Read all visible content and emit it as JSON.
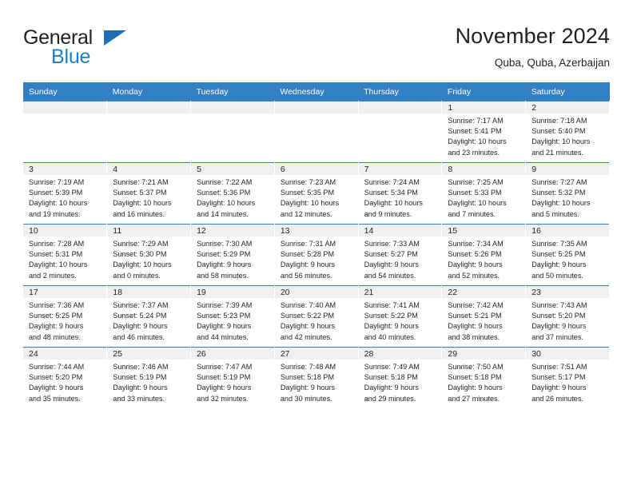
{
  "brand": {
    "name_part1": "General",
    "name_part2": "Blue",
    "triangle_color": "#1d6fb4",
    "blue_color": "#1d7dc4"
  },
  "header": {
    "title": "November 2024",
    "location": "Quba, Quba, Azerbaijan",
    "header_bg_color": "#3280c3",
    "daynum_band_color": "#f0f0f0"
  },
  "weekday_headers": [
    "Sunday",
    "Monday",
    "Tuesday",
    "Wednesday",
    "Thursday",
    "Friday",
    "Saturday"
  ],
  "weeks": [
    [
      {
        "day": "",
        "sunrise": "",
        "sunset": "",
        "daylight_line1": "",
        "daylight_line2": ""
      },
      {
        "day": "",
        "sunrise": "",
        "sunset": "",
        "daylight_line1": "",
        "daylight_line2": ""
      },
      {
        "day": "",
        "sunrise": "",
        "sunset": "",
        "daylight_line1": "",
        "daylight_line2": ""
      },
      {
        "day": "",
        "sunrise": "",
        "sunset": "",
        "daylight_line1": "",
        "daylight_line2": ""
      },
      {
        "day": "",
        "sunrise": "",
        "sunset": "",
        "daylight_line1": "",
        "daylight_line2": ""
      },
      {
        "day": "1",
        "sunrise": "Sunrise: 7:17 AM",
        "sunset": "Sunset: 5:41 PM",
        "daylight_line1": "Daylight: 10 hours",
        "daylight_line2": "and 23 minutes."
      },
      {
        "day": "2",
        "sunrise": "Sunrise: 7:18 AM",
        "sunset": "Sunset: 5:40 PM",
        "daylight_line1": "Daylight: 10 hours",
        "daylight_line2": "and 21 minutes."
      }
    ],
    [
      {
        "day": "3",
        "sunrise": "Sunrise: 7:19 AM",
        "sunset": "Sunset: 5:39 PM",
        "daylight_line1": "Daylight: 10 hours",
        "daylight_line2": "and 19 minutes."
      },
      {
        "day": "4",
        "sunrise": "Sunrise: 7:21 AM",
        "sunset": "Sunset: 5:37 PM",
        "daylight_line1": "Daylight: 10 hours",
        "daylight_line2": "and 16 minutes."
      },
      {
        "day": "5",
        "sunrise": "Sunrise: 7:22 AM",
        "sunset": "Sunset: 5:36 PM",
        "daylight_line1": "Daylight: 10 hours",
        "daylight_line2": "and 14 minutes."
      },
      {
        "day": "6",
        "sunrise": "Sunrise: 7:23 AM",
        "sunset": "Sunset: 5:35 PM",
        "daylight_line1": "Daylight: 10 hours",
        "daylight_line2": "and 12 minutes."
      },
      {
        "day": "7",
        "sunrise": "Sunrise: 7:24 AM",
        "sunset": "Sunset: 5:34 PM",
        "daylight_line1": "Daylight: 10 hours",
        "daylight_line2": "and 9 minutes."
      },
      {
        "day": "8",
        "sunrise": "Sunrise: 7:25 AM",
        "sunset": "Sunset: 5:33 PM",
        "daylight_line1": "Daylight: 10 hours",
        "daylight_line2": "and 7 minutes."
      },
      {
        "day": "9",
        "sunrise": "Sunrise: 7:27 AM",
        "sunset": "Sunset: 5:32 PM",
        "daylight_line1": "Daylight: 10 hours",
        "daylight_line2": "and 5 minutes."
      }
    ],
    [
      {
        "day": "10",
        "sunrise": "Sunrise: 7:28 AM",
        "sunset": "Sunset: 5:31 PM",
        "daylight_line1": "Daylight: 10 hours",
        "daylight_line2": "and 2 minutes."
      },
      {
        "day": "11",
        "sunrise": "Sunrise: 7:29 AM",
        "sunset": "Sunset: 5:30 PM",
        "daylight_line1": "Daylight: 10 hours",
        "daylight_line2": "and 0 minutes."
      },
      {
        "day": "12",
        "sunrise": "Sunrise: 7:30 AM",
        "sunset": "Sunset: 5:29 PM",
        "daylight_line1": "Daylight: 9 hours",
        "daylight_line2": "and 58 minutes."
      },
      {
        "day": "13",
        "sunrise": "Sunrise: 7:31 AM",
        "sunset": "Sunset: 5:28 PM",
        "daylight_line1": "Daylight: 9 hours",
        "daylight_line2": "and 56 minutes."
      },
      {
        "day": "14",
        "sunrise": "Sunrise: 7:33 AM",
        "sunset": "Sunset: 5:27 PM",
        "daylight_line1": "Daylight: 9 hours",
        "daylight_line2": "and 54 minutes."
      },
      {
        "day": "15",
        "sunrise": "Sunrise: 7:34 AM",
        "sunset": "Sunset: 5:26 PM",
        "daylight_line1": "Daylight: 9 hours",
        "daylight_line2": "and 52 minutes."
      },
      {
        "day": "16",
        "sunrise": "Sunrise: 7:35 AM",
        "sunset": "Sunset: 5:25 PM",
        "daylight_line1": "Daylight: 9 hours",
        "daylight_line2": "and 50 minutes."
      }
    ],
    [
      {
        "day": "17",
        "sunrise": "Sunrise: 7:36 AM",
        "sunset": "Sunset: 5:25 PM",
        "daylight_line1": "Daylight: 9 hours",
        "daylight_line2": "and 48 minutes."
      },
      {
        "day": "18",
        "sunrise": "Sunrise: 7:37 AM",
        "sunset": "Sunset: 5:24 PM",
        "daylight_line1": "Daylight: 9 hours",
        "daylight_line2": "and 46 minutes."
      },
      {
        "day": "19",
        "sunrise": "Sunrise: 7:39 AM",
        "sunset": "Sunset: 5:23 PM",
        "daylight_line1": "Daylight: 9 hours",
        "daylight_line2": "and 44 minutes."
      },
      {
        "day": "20",
        "sunrise": "Sunrise: 7:40 AM",
        "sunset": "Sunset: 5:22 PM",
        "daylight_line1": "Daylight: 9 hours",
        "daylight_line2": "and 42 minutes."
      },
      {
        "day": "21",
        "sunrise": "Sunrise: 7:41 AM",
        "sunset": "Sunset: 5:22 PM",
        "daylight_line1": "Daylight: 9 hours",
        "daylight_line2": "and 40 minutes."
      },
      {
        "day": "22",
        "sunrise": "Sunrise: 7:42 AM",
        "sunset": "Sunset: 5:21 PM",
        "daylight_line1": "Daylight: 9 hours",
        "daylight_line2": "and 38 minutes."
      },
      {
        "day": "23",
        "sunrise": "Sunrise: 7:43 AM",
        "sunset": "Sunset: 5:20 PM",
        "daylight_line1": "Daylight: 9 hours",
        "daylight_line2": "and 37 minutes."
      }
    ],
    [
      {
        "day": "24",
        "sunrise": "Sunrise: 7:44 AM",
        "sunset": "Sunset: 5:20 PM",
        "daylight_line1": "Daylight: 9 hours",
        "daylight_line2": "and 35 minutes."
      },
      {
        "day": "25",
        "sunrise": "Sunrise: 7:46 AM",
        "sunset": "Sunset: 5:19 PM",
        "daylight_line1": "Daylight: 9 hours",
        "daylight_line2": "and 33 minutes."
      },
      {
        "day": "26",
        "sunrise": "Sunrise: 7:47 AM",
        "sunset": "Sunset: 5:19 PM",
        "daylight_line1": "Daylight: 9 hours",
        "daylight_line2": "and 32 minutes."
      },
      {
        "day": "27",
        "sunrise": "Sunrise: 7:48 AM",
        "sunset": "Sunset: 5:18 PM",
        "daylight_line1": "Daylight: 9 hours",
        "daylight_line2": "and 30 minutes."
      },
      {
        "day": "28",
        "sunrise": "Sunrise: 7:49 AM",
        "sunset": "Sunset: 5:18 PM",
        "daylight_line1": "Daylight: 9 hours",
        "daylight_line2": "and 29 minutes."
      },
      {
        "day": "29",
        "sunrise": "Sunrise: 7:50 AM",
        "sunset": "Sunset: 5:18 PM",
        "daylight_line1": "Daylight: 9 hours",
        "daylight_line2": "and 27 minutes."
      },
      {
        "day": "30",
        "sunrise": "Sunrise: 7:51 AM",
        "sunset": "Sunset: 5:17 PM",
        "daylight_line1": "Daylight: 9 hours",
        "daylight_line2": "and 26 minutes."
      }
    ]
  ]
}
